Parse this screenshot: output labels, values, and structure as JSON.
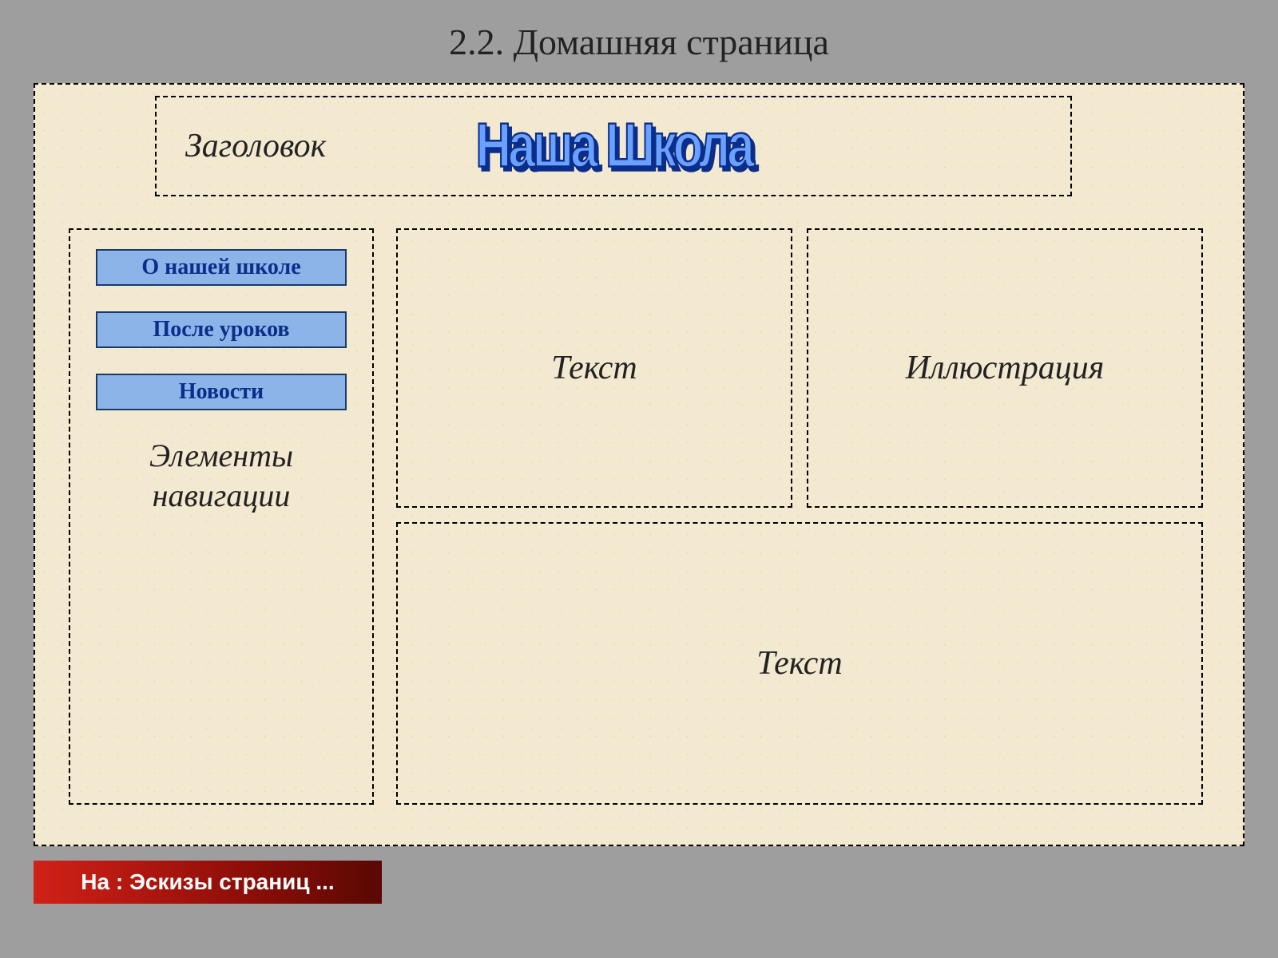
{
  "title": "2.2. Домашняя страница",
  "header": {
    "label": "Заголовок",
    "wordart": "Наша Школа"
  },
  "nav": {
    "buttons": [
      "О нашей школе",
      "После уроков",
      "Новости"
    ],
    "caption_line1": "Элементы",
    "caption_line2": "навигации"
  },
  "blocks": {
    "text1": "Текст",
    "illustration": "Иллюстрация",
    "text2": "Текст"
  },
  "bottom_button": "На : Эскизы страниц ..."
}
